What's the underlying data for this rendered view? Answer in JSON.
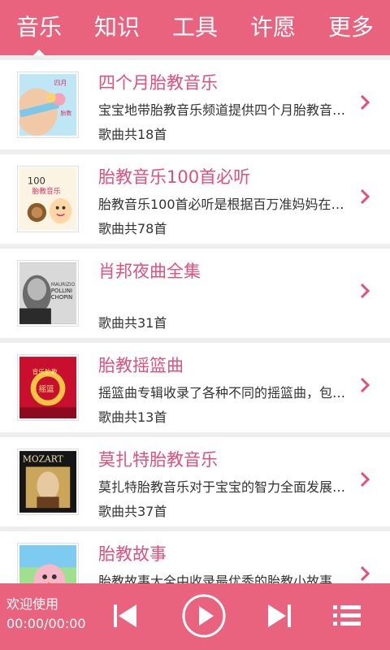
{
  "tabs": [
    {
      "label": "音乐",
      "active": true
    },
    {
      "label": "知识",
      "active": false
    },
    {
      "label": "工具",
      "active": false
    },
    {
      "label": "许愿",
      "active": false
    },
    {
      "label": "更多",
      "active": false
    }
  ],
  "colors": {
    "accent": "#e9637e",
    "title_text": "#e0507a",
    "background": "#eeeeee"
  },
  "list": [
    {
      "title": "四个月胎教音乐",
      "desc": "宝宝地带胎教音乐频道提供四个月胎教音乐…",
      "count": "歌曲共18首",
      "thumb_icon": "pregnant-belly-cover",
      "thumb_text": "四月胎教音乐"
    },
    {
      "title": "胎教音乐100首必听",
      "desc": "胎教音乐100首必听是根据百万准妈妈在宝…",
      "count": "歌曲共78首",
      "thumb_icon": "snail-cover",
      "thumb_text": "100 胎教音乐"
    },
    {
      "title": "肖邦夜曲全集",
      "desc": "",
      "count": "歌曲共31首",
      "thumb_icon": "pollini-chopin-cover",
      "thumb_text": "POLLINI CHOPIN"
    },
    {
      "title": "胎教摇篮曲",
      "desc": "摇篮曲专辑收录了各种不同的摇篮曲，包含…",
      "count": "歌曲共13首",
      "thumb_icon": "lullaby-cover",
      "thumb_text": "音乐胎教"
    },
    {
      "title": "莫扎特胎教音乐",
      "desc": "莫扎特胎教音乐对于宝宝的智力全面发展确…",
      "count": "歌曲共37首",
      "thumb_icon": "mozart-cover",
      "thumb_text": "MOZART"
    },
    {
      "title": "胎教故事",
      "desc": "胎教故事大全中收录最优秀的胎教小故事，…",
      "count": "",
      "thumb_icon": "cartoon-bird-cover",
      "thumb_text": ""
    }
  ],
  "player": {
    "now_playing": "欢迎使用",
    "time": "00:00/00:00",
    "controls": [
      "previous-icon",
      "play-icon",
      "next-icon",
      "playlist-icon"
    ]
  }
}
